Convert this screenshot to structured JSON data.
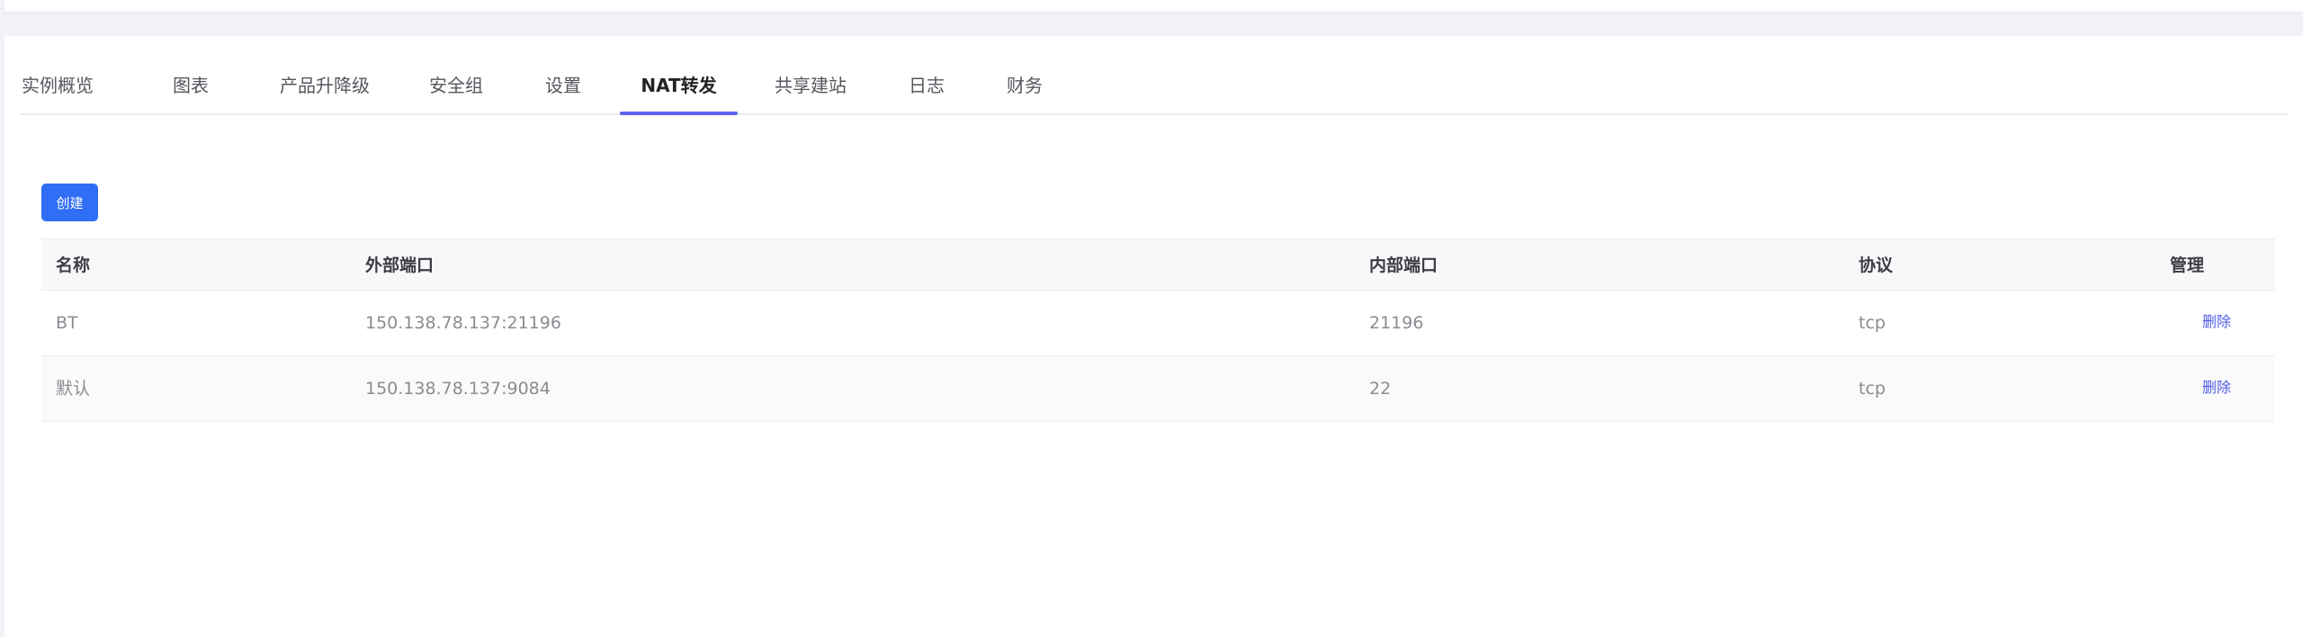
{
  "tabs": [
    {
      "label": "实例概览",
      "active": false
    },
    {
      "label": "图表",
      "active": false
    },
    {
      "label": "产品升降级",
      "active": false
    },
    {
      "label": "安全组",
      "active": false
    },
    {
      "label": "设置",
      "active": false
    },
    {
      "label": "NAT转发",
      "active": true
    },
    {
      "label": "共享建站",
      "active": false
    },
    {
      "label": "日志",
      "active": false
    },
    {
      "label": "财务",
      "active": false
    }
  ],
  "toolbar": {
    "create_label": "创建"
  },
  "colors": {
    "primary": "#2f6ef5",
    "tab_indicator": "#5a63ee",
    "link": "#4f5ee8"
  },
  "table": {
    "headers": [
      "名称",
      "外部端口",
      "内部端口",
      "协议",
      "管理"
    ],
    "rows": [
      {
        "name": "BT",
        "external_port": "150.138.78.137:21196",
        "internal_port": "21196",
        "protocol": "tcp",
        "action": "删除"
      },
      {
        "name": "默认",
        "external_port": "150.138.78.137:9084",
        "internal_port": "22",
        "protocol": "tcp",
        "action": "删除"
      }
    ]
  }
}
